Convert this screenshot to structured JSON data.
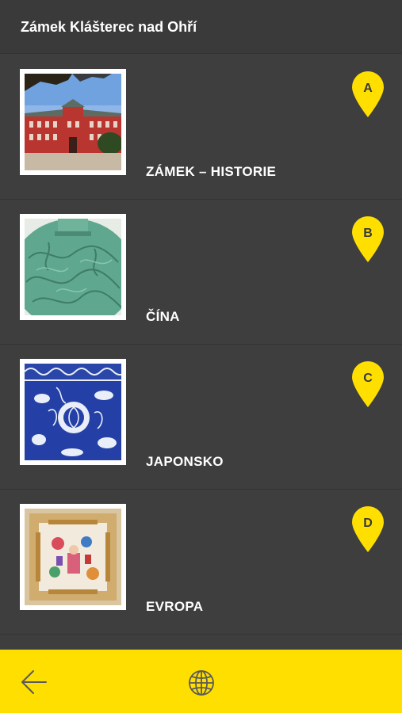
{
  "header": {
    "title": "Zámek Klášterec nad Ohří"
  },
  "items": [
    {
      "label": "ZÁMEK – HISTORIE",
      "marker": "A",
      "image": "castle-photo"
    },
    {
      "label": "ČÍNA",
      "marker": "B",
      "image": "celadon-vase-photo"
    },
    {
      "label": "JAPONSKO",
      "marker": "C",
      "image": "blue-porcelain-photo"
    },
    {
      "label": "EVROPA",
      "marker": "D",
      "image": "painted-plate-photo"
    }
  ],
  "bottom_bar": {
    "back_icon": "back-arrow-icon",
    "language_icon": "globe-icon"
  },
  "colors": {
    "accent": "#ffdf00",
    "background": "#3e3e3e",
    "header": "#3a3a3a"
  }
}
